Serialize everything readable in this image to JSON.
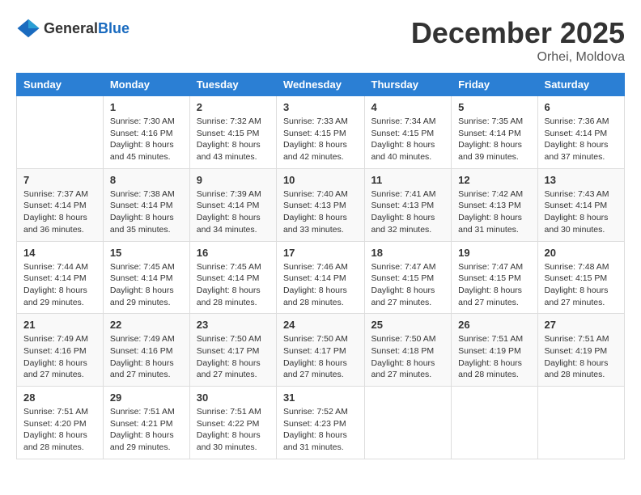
{
  "header": {
    "logo_general": "General",
    "logo_blue": "Blue",
    "month_title": "December 2025",
    "location": "Orhei, Moldova"
  },
  "calendar": {
    "days_of_week": [
      "Sunday",
      "Monday",
      "Tuesday",
      "Wednesday",
      "Thursday",
      "Friday",
      "Saturday"
    ],
    "weeks": [
      [
        {
          "day": "",
          "info": ""
        },
        {
          "day": "1",
          "info": "Sunrise: 7:30 AM\nSunset: 4:16 PM\nDaylight: 8 hours\nand 45 minutes."
        },
        {
          "day": "2",
          "info": "Sunrise: 7:32 AM\nSunset: 4:15 PM\nDaylight: 8 hours\nand 43 minutes."
        },
        {
          "day": "3",
          "info": "Sunrise: 7:33 AM\nSunset: 4:15 PM\nDaylight: 8 hours\nand 42 minutes."
        },
        {
          "day": "4",
          "info": "Sunrise: 7:34 AM\nSunset: 4:15 PM\nDaylight: 8 hours\nand 40 minutes."
        },
        {
          "day": "5",
          "info": "Sunrise: 7:35 AM\nSunset: 4:14 PM\nDaylight: 8 hours\nand 39 minutes."
        },
        {
          "day": "6",
          "info": "Sunrise: 7:36 AM\nSunset: 4:14 PM\nDaylight: 8 hours\nand 37 minutes."
        }
      ],
      [
        {
          "day": "7",
          "info": "Sunrise: 7:37 AM\nSunset: 4:14 PM\nDaylight: 8 hours\nand 36 minutes."
        },
        {
          "day": "8",
          "info": "Sunrise: 7:38 AM\nSunset: 4:14 PM\nDaylight: 8 hours\nand 35 minutes."
        },
        {
          "day": "9",
          "info": "Sunrise: 7:39 AM\nSunset: 4:14 PM\nDaylight: 8 hours\nand 34 minutes."
        },
        {
          "day": "10",
          "info": "Sunrise: 7:40 AM\nSunset: 4:13 PM\nDaylight: 8 hours\nand 33 minutes."
        },
        {
          "day": "11",
          "info": "Sunrise: 7:41 AM\nSunset: 4:13 PM\nDaylight: 8 hours\nand 32 minutes."
        },
        {
          "day": "12",
          "info": "Sunrise: 7:42 AM\nSunset: 4:13 PM\nDaylight: 8 hours\nand 31 minutes."
        },
        {
          "day": "13",
          "info": "Sunrise: 7:43 AM\nSunset: 4:14 PM\nDaylight: 8 hours\nand 30 minutes."
        }
      ],
      [
        {
          "day": "14",
          "info": "Sunrise: 7:44 AM\nSunset: 4:14 PM\nDaylight: 8 hours\nand 29 minutes."
        },
        {
          "day": "15",
          "info": "Sunrise: 7:45 AM\nSunset: 4:14 PM\nDaylight: 8 hours\nand 29 minutes."
        },
        {
          "day": "16",
          "info": "Sunrise: 7:45 AM\nSunset: 4:14 PM\nDaylight: 8 hours\nand 28 minutes."
        },
        {
          "day": "17",
          "info": "Sunrise: 7:46 AM\nSunset: 4:14 PM\nDaylight: 8 hours\nand 28 minutes."
        },
        {
          "day": "18",
          "info": "Sunrise: 7:47 AM\nSunset: 4:15 PM\nDaylight: 8 hours\nand 27 minutes."
        },
        {
          "day": "19",
          "info": "Sunrise: 7:47 AM\nSunset: 4:15 PM\nDaylight: 8 hours\nand 27 minutes."
        },
        {
          "day": "20",
          "info": "Sunrise: 7:48 AM\nSunset: 4:15 PM\nDaylight: 8 hours\nand 27 minutes."
        }
      ],
      [
        {
          "day": "21",
          "info": "Sunrise: 7:49 AM\nSunset: 4:16 PM\nDaylight: 8 hours\nand 27 minutes."
        },
        {
          "day": "22",
          "info": "Sunrise: 7:49 AM\nSunset: 4:16 PM\nDaylight: 8 hours\nand 27 minutes."
        },
        {
          "day": "23",
          "info": "Sunrise: 7:50 AM\nSunset: 4:17 PM\nDaylight: 8 hours\nand 27 minutes."
        },
        {
          "day": "24",
          "info": "Sunrise: 7:50 AM\nSunset: 4:17 PM\nDaylight: 8 hours\nand 27 minutes."
        },
        {
          "day": "25",
          "info": "Sunrise: 7:50 AM\nSunset: 4:18 PM\nDaylight: 8 hours\nand 27 minutes."
        },
        {
          "day": "26",
          "info": "Sunrise: 7:51 AM\nSunset: 4:19 PM\nDaylight: 8 hours\nand 28 minutes."
        },
        {
          "day": "27",
          "info": "Sunrise: 7:51 AM\nSunset: 4:19 PM\nDaylight: 8 hours\nand 28 minutes."
        }
      ],
      [
        {
          "day": "28",
          "info": "Sunrise: 7:51 AM\nSunset: 4:20 PM\nDaylight: 8 hours\nand 28 minutes."
        },
        {
          "day": "29",
          "info": "Sunrise: 7:51 AM\nSunset: 4:21 PM\nDaylight: 8 hours\nand 29 minutes."
        },
        {
          "day": "30",
          "info": "Sunrise: 7:51 AM\nSunset: 4:22 PM\nDaylight: 8 hours\nand 30 minutes."
        },
        {
          "day": "31",
          "info": "Sunrise: 7:52 AM\nSunset: 4:23 PM\nDaylight: 8 hours\nand 31 minutes."
        },
        {
          "day": "",
          "info": ""
        },
        {
          "day": "",
          "info": ""
        },
        {
          "day": "",
          "info": ""
        }
      ]
    ]
  }
}
